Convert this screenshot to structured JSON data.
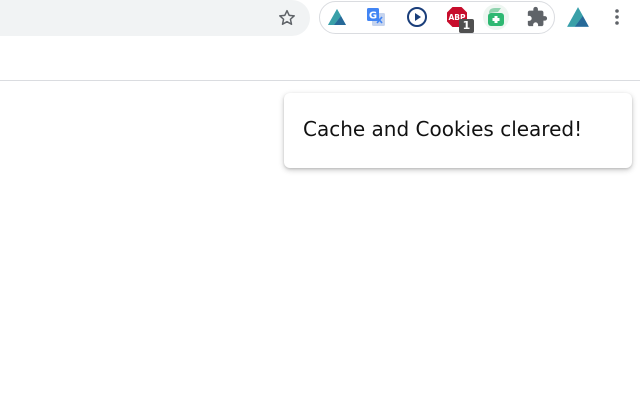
{
  "browser": {
    "toolbar": {
      "bookmark_icon": "star-outline-icon",
      "extensions": [
        {
          "icon": "triangle-logo-icon",
          "color": "#3aa0a8"
        },
        {
          "icon": "google-translate-icon",
          "color": "#4285f4"
        },
        {
          "icon": "play-circle-icon",
          "color": "#1a3e7a"
        },
        {
          "icon": "adblock-plus-icon",
          "color": "#c70d2c",
          "badge": "ABP",
          "count": "1"
        },
        {
          "icon": "cookie-cleaner-icon",
          "color": "#2eb872"
        }
      ],
      "puzzle_icon": "puzzle-extensions-icon",
      "profile_icon": "triangle-logo-icon",
      "menu_icon": "kebab-menu-icon"
    }
  },
  "popup": {
    "message": "Cache and Cookies cleared!"
  }
}
